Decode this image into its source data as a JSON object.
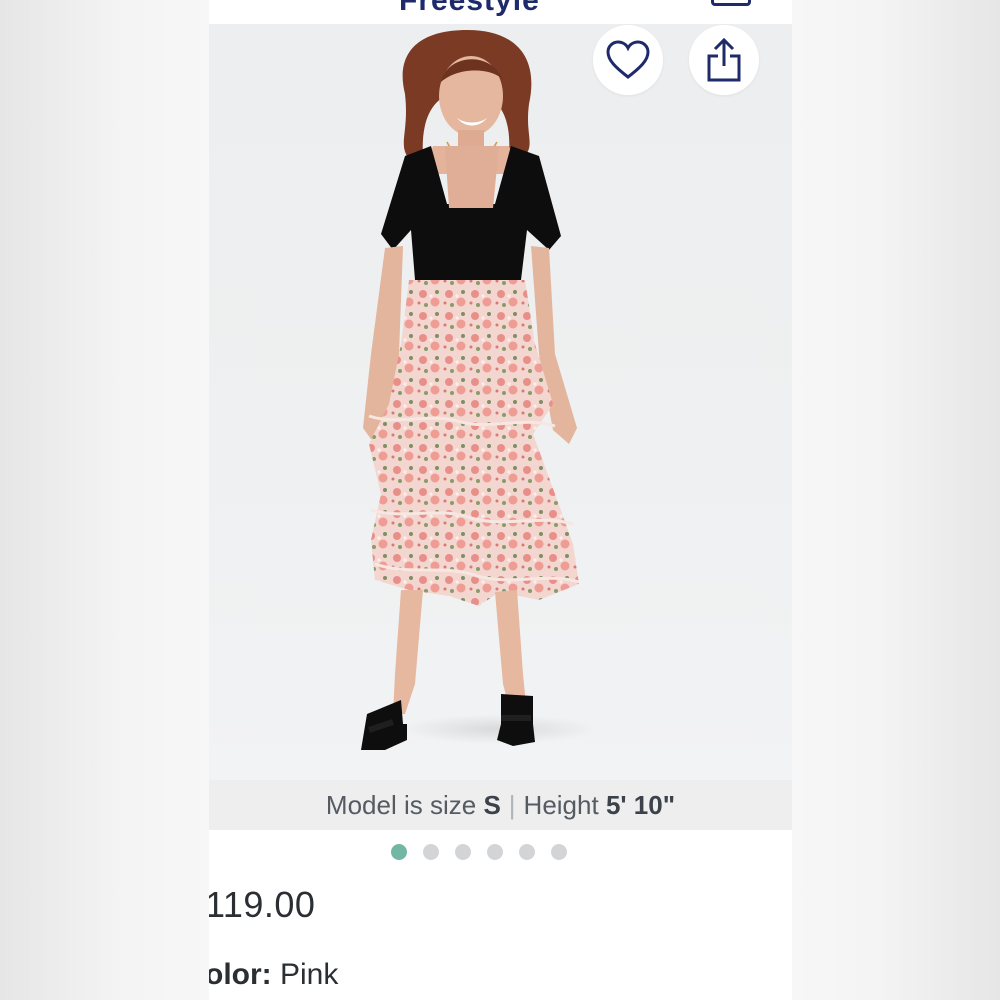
{
  "header": {
    "brand_fragment": "Freestyle"
  },
  "product_image": {
    "favorite_icon": "heart-outline-icon",
    "share_icon": "share-upload-icon"
  },
  "model_info": {
    "size_label": "Model is size",
    "size_value": "S",
    "separator": "|",
    "height_label": "Height",
    "height_value": "5' 10\""
  },
  "carousel": {
    "total": 6,
    "active_index": 0,
    "active_color": "#72b7a4",
    "inactive_color": "#d3d4d6"
  },
  "product": {
    "price": "119.00",
    "color_label": "olor:",
    "color_value": "Pink"
  }
}
